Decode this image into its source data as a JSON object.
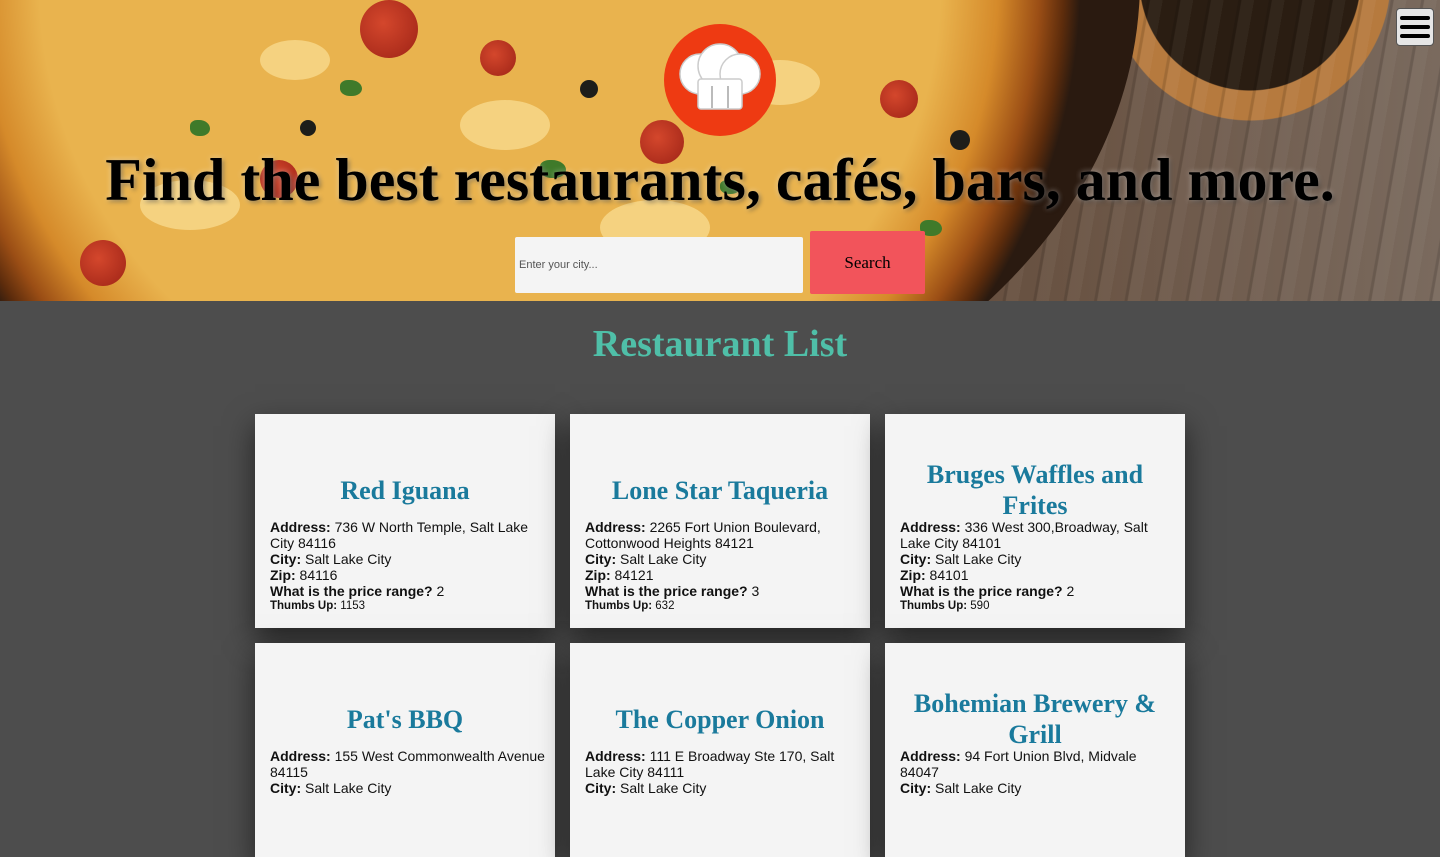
{
  "hero": {
    "title": "Find the best restaurants, cafés, bars, and more.",
    "logo_icon": "chef-hat-icon",
    "menu_icon": "hamburger-menu-icon",
    "search": {
      "placeholder": "Enter your city...",
      "value": "",
      "button_label": "Search"
    }
  },
  "list": {
    "title": "Restaurant List",
    "labels": {
      "address": "Address:",
      "city": "City:",
      "zip": "Zip:",
      "price": "What is the price range?",
      "thumbs": "Thumbs Up:"
    },
    "restaurants": [
      {
        "name": "Red Iguana",
        "address": "736 W North Temple, Salt Lake City 84116",
        "city": "Salt Lake City",
        "zip": "84116",
        "price": "2",
        "thumbs": "1153"
      },
      {
        "name": "Lone Star Taqueria",
        "address": "2265 Fort Union Boulevard, Cottonwood Heights 84121",
        "city": "Salt Lake City",
        "zip": "84121",
        "price": "3",
        "thumbs": "632"
      },
      {
        "name": "Bruges Waffles and Frites",
        "address": "336 West 300,Broadway, Salt Lake City 84101",
        "city": "Salt Lake City",
        "zip": "84101",
        "price": "2",
        "thumbs": "590"
      },
      {
        "name": "Pat's BBQ",
        "address": "155 West Commonwealth Avenue 84115",
        "city": "Salt Lake City",
        "zip": "",
        "price": "",
        "thumbs": ""
      },
      {
        "name": "The Copper Onion",
        "address": "111 E Broadway Ste 170, Salt Lake City 84111",
        "city": "Salt Lake City",
        "zip": "",
        "price": "",
        "thumbs": ""
      },
      {
        "name": "Bohemian Brewery & Grill",
        "address": "94 Fort Union Blvd, Midvale 84047",
        "city": "Salt Lake City",
        "zip": "",
        "price": "",
        "thumbs": ""
      }
    ]
  },
  "colors": {
    "page_bg": "#4d4d4d",
    "accent_title": "#4fbfa8",
    "card_title": "#1a7a9c",
    "search_button": "#f2545b",
    "logo_bg": "#ee3a12"
  }
}
